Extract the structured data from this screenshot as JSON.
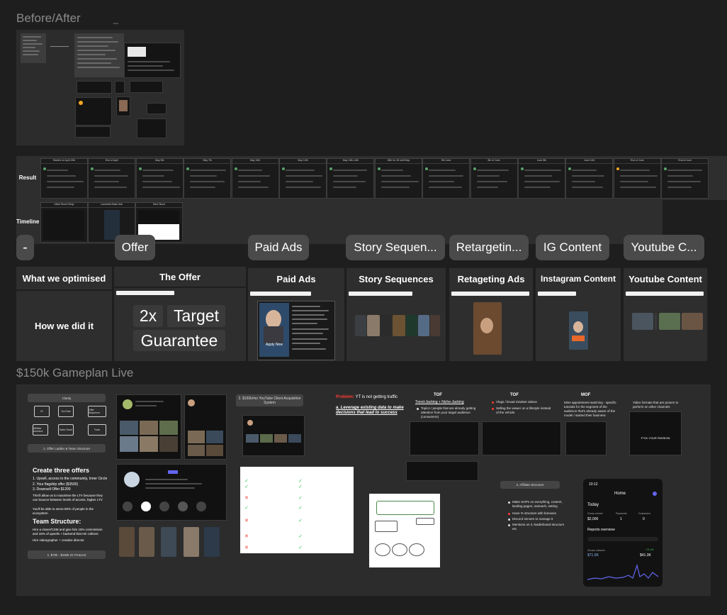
{
  "frames": {
    "before_after": "Before/After",
    "gameplan": "$150k Gameplan Live"
  },
  "before_after_cursor": "_",
  "result_row": {
    "result_label": "Result",
    "timeline_label": "Timeline",
    "result_columns": [
      "Started on April 19th",
      "End of April",
      "May 5th",
      "May 7th",
      "May 10th",
      "May 12th",
      "May 13th-14th",
      "18th for 28 until May",
      "5th June",
      "5th of June",
      "June 8th",
      "June 11th",
      "End of June",
      "End of June"
    ],
    "timeline_columns": [
      "Initial Skool Setup",
      "Launched Base Ads",
      "Next Skool"
    ]
  },
  "tabs": {
    "collapse": "-",
    "items": [
      "Offer",
      "Paid Ads",
      "Story Sequen...",
      "Retargetin...",
      "IG Content",
      "Youtube C..."
    ]
  },
  "table": {
    "row_what": "What we optimised",
    "row_how": "How we did it",
    "columns": [
      "The Offer",
      "Paid Ads",
      "Story Sequences",
      "Retageting Ads",
      "Instagram Content",
      "Youtube Content"
    ],
    "offer_badges": {
      "two_x": "2x",
      "target": "Target",
      "guarantee": "Guarantee"
    },
    "ad_overlay": "Apply Now"
  },
  "gameplan": {
    "clarity": "Clarity",
    "ladder_boxes": [
      "IG",
      "YouTube",
      "Offer Sequence",
      "Affiliate structure",
      "Sales Team",
      "Tools"
    ],
    "ladder_label": "1. Offer Ladder & Team Structure",
    "offers_heading": "Create three offers",
    "offers": [
      "1. Upsell, access to the community, Inner Circle",
      "2. Your flagship offer ($3500)",
      "3. Downsell Offer $1200"
    ],
    "offers_note": "This'll allow us to maximise the LTV because they can bounce between levels of access, higher LTV",
    "offers_note2": "You'll be able to serve 80% of people in the ecosystem",
    "team_heading": "Team Structure:",
    "team_text": "Hire a closer/CSM and give him 15% commission and 15% of upsells + backend that HE collects",
    "team_text2": "Hire videographer + creative director",
    "ig_protocol": "1. $70k - $150k IG Protocol",
    "yt_title": "2. $150k/mo YouTube Client Acquisition System",
    "problem_prefix": "Problem:",
    "problem_text": "YT is not getting traffic",
    "leverage": "a. Leverage existing data to make decisions that lead to success",
    "tof1": "TOF",
    "tof1_sub": "Trend-Jacking + Niche-Jacking",
    "tof1_bullet": "Topics / people that are already getting attention from your target audience (consumers)",
    "tof2": "TOF",
    "tof2_b1": "Vlogs / broad mindset videos",
    "tof2_b2": "Selling the viewer on a lifestyle instead of the vehicle",
    "mof": "MOF",
    "mof_b1": "Mine appointment watching - specific tutorials for the segment of the audience that's already aware of the model / started their business",
    "yt_formats": "Video formats that are proven to perform on other channels",
    "affiliate": "3. Affiliate Structure",
    "affiliate_bullets": [
      "Make SOPs on everything, content, landing pages, outreach, setting",
      "Have % structure with bonuses",
      "Discord servers to manage it",
      "Mentions on it, leaderboard structure etc."
    ],
    "phone": {
      "time": "10:12",
      "title": "Home",
      "today": "Today",
      "gross_volume_label": "Gross volume",
      "gross_volume": "$2,000",
      "payments_label": "Payments",
      "payments": "1",
      "customers_label": "Customers",
      "customers": "0",
      "reports": "Reports overview",
      "gross2_label": "Gross volume",
      "gross2_a": "$71.5K",
      "gross2_b": "$41.3K",
      "growth": "+11.4%"
    },
    "thumbnail_text": "F*CK YOUR PASSION"
  },
  "colors": {
    "background": "#1e1e1e",
    "frame": "#2c2c2c",
    "cell": "#2e2e2e",
    "pill": "#4a4a4a",
    "accent_red": "#ff3b30",
    "accent_green": "#34c759",
    "phone_accent": "#6366f1"
  }
}
